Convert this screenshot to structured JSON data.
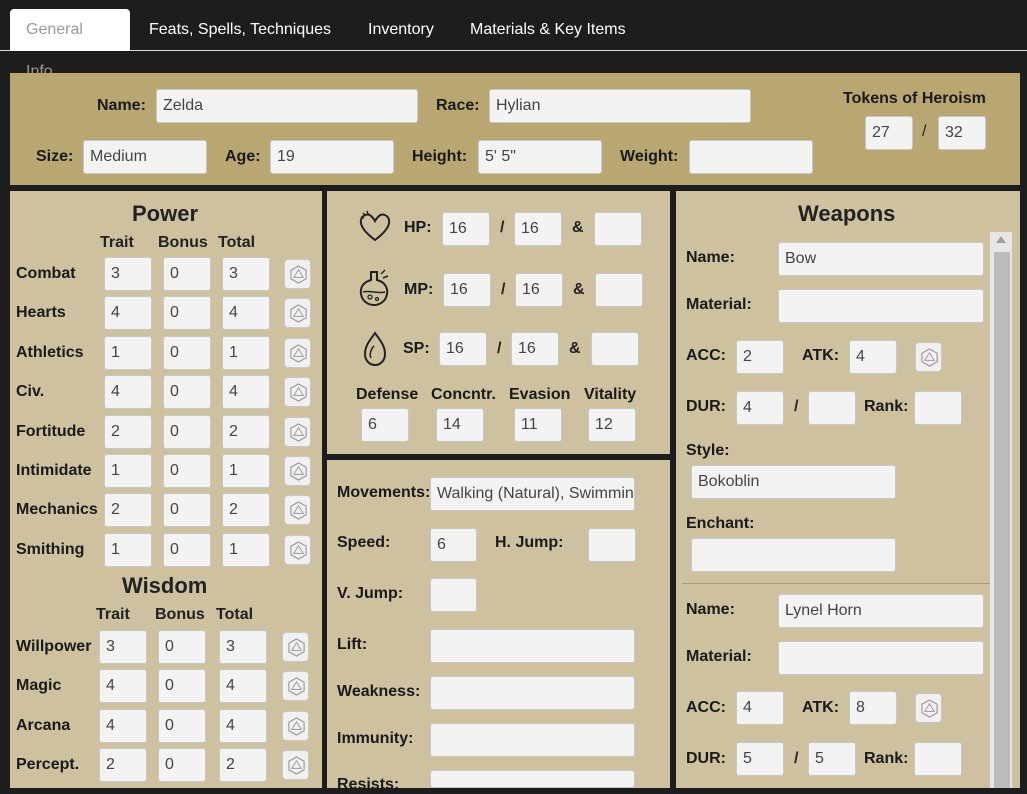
{
  "tabs": [
    "General Info",
    "Feats, Spells, Techniques",
    "Inventory",
    "Materials & Key Items"
  ],
  "top": {
    "name_label": "Name:",
    "name": "Zelda",
    "race_label": "Race:",
    "race": "Hylian",
    "size_label": "Size:",
    "size": "Medium",
    "age_label": "Age:",
    "age": "19",
    "height_label": "Height:",
    "height": "5' 5\"",
    "weight_label": "Weight:",
    "weight": "",
    "tokens_label": "Tokens of Heroism",
    "tokens_current": "27",
    "tokens_sep": "/",
    "tokens_max": "32"
  },
  "power": {
    "title": "Power",
    "col_trait": "Trait",
    "col_bonus": "Bonus",
    "col_total": "Total",
    "rows": [
      {
        "label": "Combat",
        "trait": "3",
        "bonus": "0",
        "total": "3"
      },
      {
        "label": "Hearts",
        "trait": "4",
        "bonus": "0",
        "total": "4"
      },
      {
        "label": "Athletics",
        "trait": "1",
        "bonus": "0",
        "total": "1"
      },
      {
        "label": "Civ.",
        "trait": "4",
        "bonus": "0",
        "total": "4"
      },
      {
        "label": "Fortitude",
        "trait": "2",
        "bonus": "0",
        "total": "2"
      },
      {
        "label": "Intimidate",
        "trait": "1",
        "bonus": "0",
        "total": "1"
      },
      {
        "label": "Mechanics",
        "trait": "2",
        "bonus": "0",
        "total": "2"
      },
      {
        "label": "Smithing",
        "trait": "1",
        "bonus": "0",
        "total": "1"
      }
    ]
  },
  "wisdom": {
    "title": "Wisdom",
    "col_trait": "Trait",
    "col_bonus": "Bonus",
    "col_total": "Total",
    "rows": [
      {
        "label": "Willpower",
        "trait": "3",
        "bonus": "0",
        "total": "3"
      },
      {
        "label": "Magic",
        "trait": "4",
        "bonus": "0",
        "total": "4"
      },
      {
        "label": "Arcana",
        "trait": "4",
        "bonus": "0",
        "total": "4"
      },
      {
        "label": "Percept.",
        "trait": "2",
        "bonus": "0",
        "total": "2"
      }
    ]
  },
  "vitals": {
    "hp_label": "HP:",
    "hp_cur": "16",
    "hp_max": "16",
    "hp_extra": "",
    "mp_label": "MP:",
    "mp_cur": "16",
    "mp_max": "16",
    "mp_extra": "",
    "sp_label": "SP:",
    "sp_cur": "16",
    "sp_max": "16",
    "sp_extra": "",
    "slash": "/",
    "amp": "&",
    "defense_label": "Defense",
    "defense": "6",
    "concntr_label": "Concntr.",
    "concntr": "14",
    "evasion_label": "Evasion",
    "evasion": "11",
    "vitality_label": "Vitality",
    "vitality": "12"
  },
  "movement": {
    "movements_label": "Movements:",
    "movements": "Walking (Natural), Swimming",
    "speed_label": "Speed:",
    "speed": "6",
    "hjump_label": "H. Jump:",
    "hjump": "",
    "vjump_label": "V. Jump:",
    "vjump": "",
    "lift_label": "Lift:",
    "lift": "",
    "weakness_label": "Weakness:",
    "weakness": "",
    "immunity_label": "Immunity:",
    "immunity": "",
    "resists_label": "Resists:",
    "resists": ""
  },
  "weapons": {
    "title": "Weapons",
    "name_label": "Name:",
    "material_label": "Material:",
    "acc_label": "ACC:",
    "atk_label": "ATK:",
    "dur_label": "DUR:",
    "slash": "/",
    "rank_label": "Rank:",
    "style_label": "Style:",
    "enchant_label": "Enchant:",
    "items": [
      {
        "name": "Bow",
        "material": "",
        "acc": "2",
        "atk": "4",
        "dur": "4",
        "dur_max": "",
        "rank": "",
        "style": "Bokoblin",
        "enchant": ""
      },
      {
        "name": "Lynel Horn",
        "material": "",
        "acc": "4",
        "atk": "8",
        "dur": "5",
        "dur_max": "5",
        "rank": ""
      }
    ]
  }
}
